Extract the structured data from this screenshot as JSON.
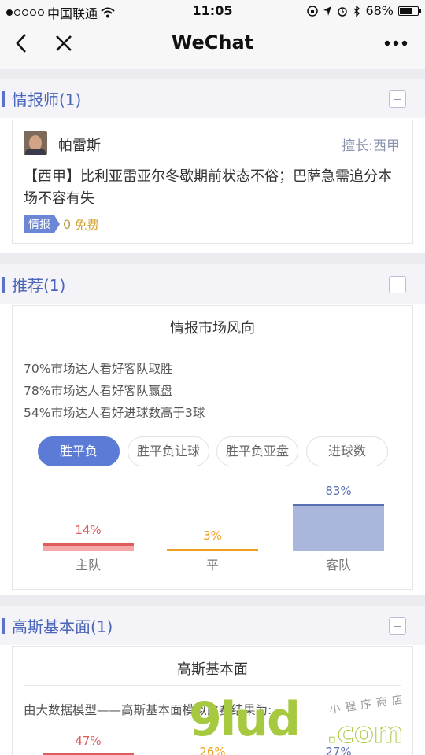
{
  "status_bar": {
    "carrier": "中国联通",
    "time": "11:05",
    "battery": "68%",
    "battery_level": 0.68
  },
  "nav": {
    "title": "WeChat"
  },
  "analyst_section": {
    "title": "情报师(1)",
    "name": "帕雷斯",
    "specialty": "擅长:西甲",
    "text": "【西甲】比利亚雷亚尔冬歇期前状态不俗；巴萨急需追分本场不容有失",
    "tag": "情报",
    "price": "0",
    "free": "免费"
  },
  "recommend_section": {
    "title": "推荐(1)",
    "card_title": "情报市场风向",
    "stats": [
      "70%市场达人看好客队取胜",
      "78%市场达人看好客队赢盘",
      "54%市场达人看好进球数高于3球"
    ],
    "tabs": [
      "胜平负",
      "胜平负让球",
      "胜平负亚盘",
      "进球数"
    ],
    "active_tab": 0,
    "colors": {
      "home": "#e05b5b",
      "draw": "#f0a020",
      "away": "#5b6fb5",
      "accent": "#5b7bd6"
    }
  },
  "chart_data": {
    "type": "bar",
    "categories": [
      "主队",
      "平",
      "客队"
    ],
    "values": [
      14,
      3,
      83
    ],
    "labels": [
      "14%",
      "3%",
      "83%"
    ],
    "ylim": [
      0,
      83
    ]
  },
  "gauss_section": {
    "title": "高斯基本面(1)",
    "card_title": "高斯基本面",
    "text": "由大数据模型——高斯基本面模拟比赛结果为:",
    "values": [
      "47%",
      "26%",
      "27%"
    ]
  },
  "watermark": {
    "logo": "9lud",
    "com": ".com",
    "cn": "小程序商店"
  }
}
